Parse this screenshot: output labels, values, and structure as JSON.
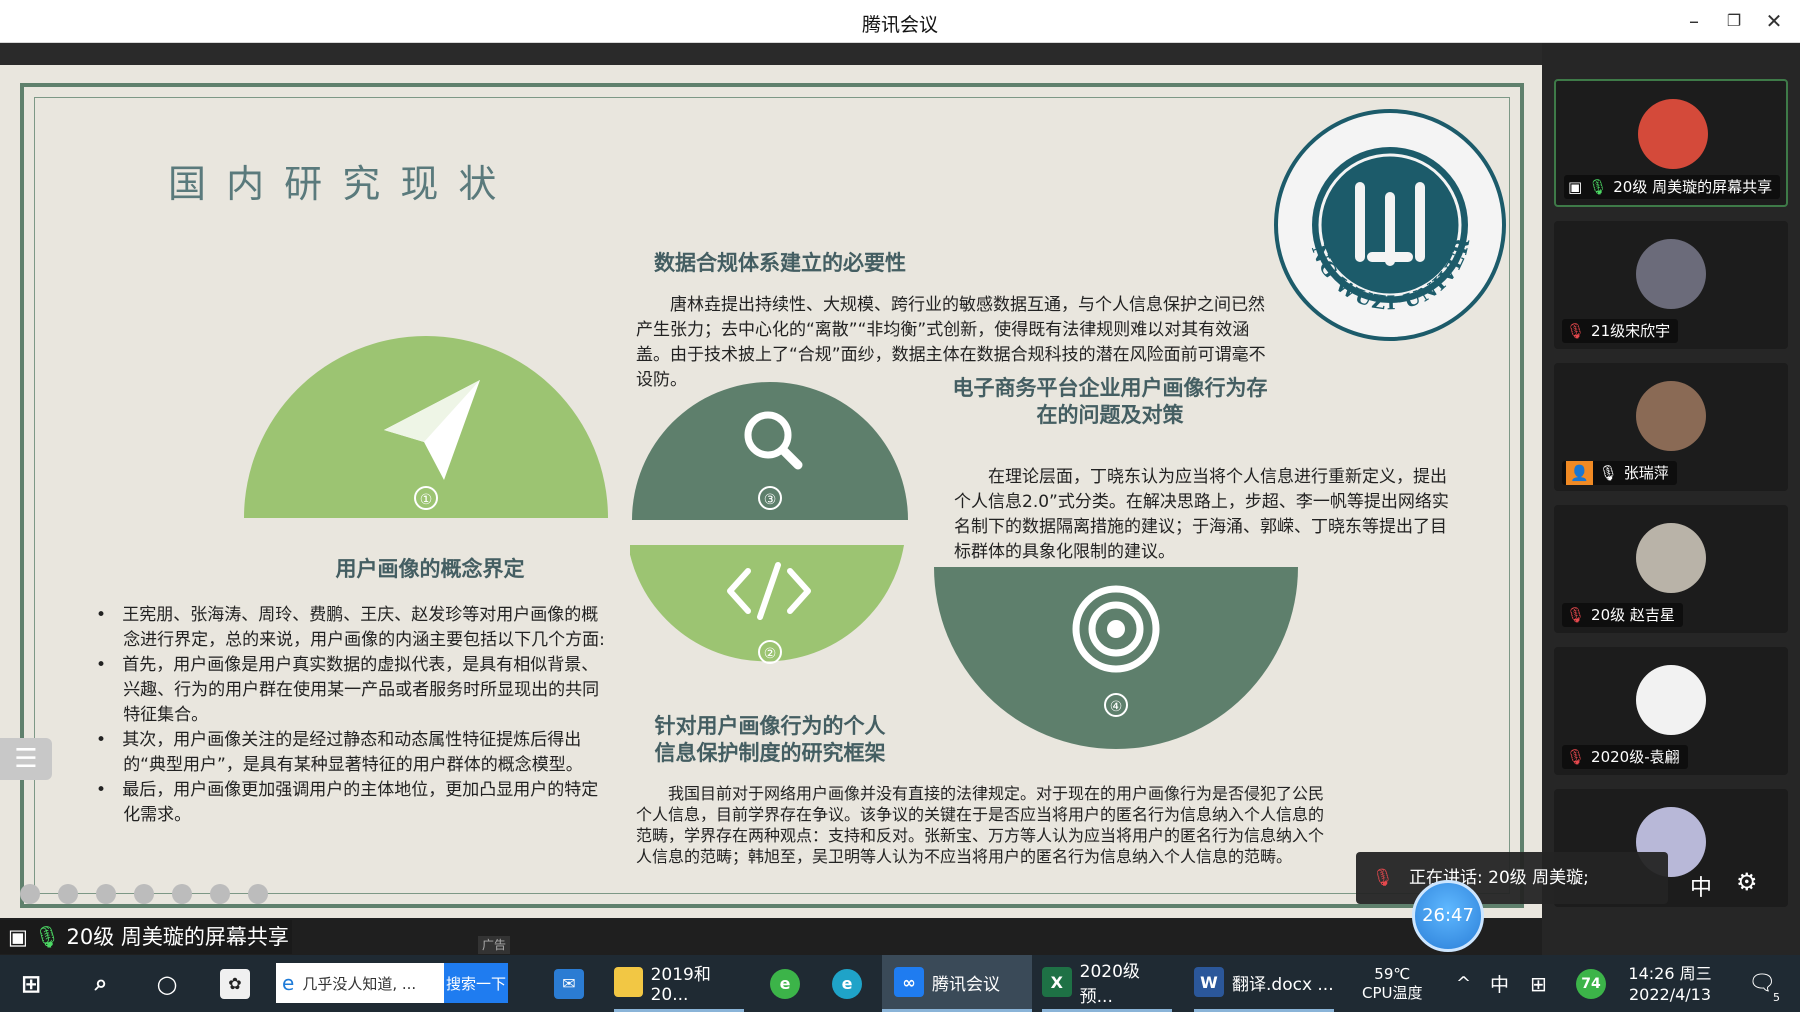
{
  "window": {
    "title": "腾讯会议"
  },
  "slide": {
    "title": "国 内 研 究 现 状",
    "university": "BEIJING WUZI UNIVERSITY",
    "badges": [
      "①",
      "②",
      "③",
      "④"
    ],
    "section1": {
      "heading": "用户画像的概念界定",
      "bullets": [
        "王宪朋、张海涛、周玲、费鹏、王庆、赵发珍等对用户画像的概念进行界定，总的来说，用户画像的内涵主要包括以下几个方面:",
        "首先，用户画像是用户真实数据的虚拟代表，是具有相似背景、兴趣、行为的用户群在使用某一产品或者服务时所显现出的共同特征集合。",
        "其次，用户画像关注的是经过静态和动态属性特征提炼后得出的“典型用户”，是具有某种显著特征的用户群体的概念模型。",
        "最后，用户画像更加强调用户的主体地位，更加凸显用户的特定化需求。"
      ]
    },
    "section2": {
      "heading": "数据合规体系建立的必要性",
      "text": "唐林垚提出持续性、大规模、跨行业的敏感数据互通，与个人信息保护之间已然产生张力；去中心化的“离散”“非均衡”式创新，使得既有法律规则难以对其有效涵盖。由于技术披上了“合规”面纱，数据主体在数据合规科技的潜在风险面前可谓毫不设防。"
    },
    "section3": {
      "heading_line1": "电子商务平台企业用户画像行为存",
      "heading_line2": "在的问题及对策",
      "text": "在理论层面，丁晓东认为应当将个人信息进行重新定义，提出个人信息2.0”式分类。在解决思路上，步超、李一帆等提出网络实名制下的数据隔离措施的建议；于海涌、郭嵘、丁晓东等提出了目标群体的具象化限制的建议。"
    },
    "section4": {
      "heading_line1": "针对用户画像行为的个人",
      "heading_line2": "信息保护制度的研究框架",
      "text": "我国目前对于网络用户画像并没有直接的法律规定。对于现在的用户画像行为是否侵犯了公民个人信息，目前学界存在争议。该争议的关键在于是否应当将用户的匿名行为信息纳入个人信息的范畴，学界存在两种观点：支持和反对。张新宝、万方等人认为应当将用户的匿名行为信息纳入个人信息的范畴；韩旭至，吴卫明等人认为不应当将用户的匿名行为信息纳入个人信息的范畴。"
    }
  },
  "participants": [
    {
      "name": "20级 周美璇的屏幕共享",
      "avatar_color": "#d44a3a",
      "mic": "on"
    },
    {
      "name": "21级宋欣宇",
      "avatar_color": "#6b6b7a",
      "mic": "muted"
    },
    {
      "name": "张瑞萍",
      "avatar_color": "#8a6a55",
      "mic": "on"
    },
    {
      "name": "20级 赵吉星",
      "avatar_color": "#b9b3a8",
      "mic": "muted"
    },
    {
      "name": "2020级-袁翩",
      "avatar_color": "#f2f2f2",
      "mic": "muted"
    }
  ],
  "overlay": {
    "share_label": "20级 周美璇的屏幕共享",
    "ad_tag": "广告",
    "speaking": "正在讲话: 20级 周美璇;",
    "timer": "26:47",
    "ime": "中"
  },
  "taskbar": {
    "search_text": "几乎没人知道, ...",
    "search_button": "搜索一下",
    "items": [
      "2019和20...",
      "腾讯会议",
      "2020级预...",
      "翻译.docx ..."
    ],
    "weather_temp": "59℃",
    "weather_label": "CPU温度",
    "ime": "中",
    "battery": "74",
    "time": "14:26 周三",
    "date": "2022/4/13",
    "notifications": "5"
  }
}
